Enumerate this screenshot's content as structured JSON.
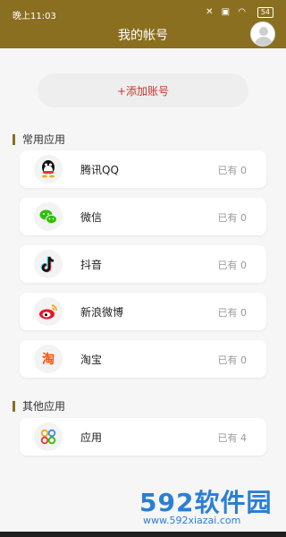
{
  "status": {
    "time": "晚上11:03",
    "battery": "54"
  },
  "header": {
    "title": "我的帐号"
  },
  "add_button": {
    "label": "+添加账号"
  },
  "sections": [
    {
      "title": "常用应用",
      "items": [
        {
          "label": "腾讯QQ",
          "count": "已有 0",
          "icon": "qq-icon"
        },
        {
          "label": "微信",
          "count": "已有 0",
          "icon": "wechat-icon"
        },
        {
          "label": "抖音",
          "count": "已有 0",
          "icon": "douyin-icon"
        },
        {
          "label": "新浪微博",
          "count": "已有 0",
          "icon": "weibo-icon"
        },
        {
          "label": "淘宝",
          "count": "已有 0",
          "icon": "taobao-icon"
        }
      ]
    },
    {
      "title": "其他应用",
      "items": [
        {
          "label": "应用",
          "count": "已有 4",
          "icon": "apps-icon"
        }
      ]
    }
  ],
  "watermark": {
    "brand": "592软件园",
    "url": "www.592xiazai.com"
  },
  "colors": {
    "header": "#8b6f20",
    "add_text": "#c0392b",
    "card": "#ffffff",
    "background": "#f6f6f6"
  }
}
